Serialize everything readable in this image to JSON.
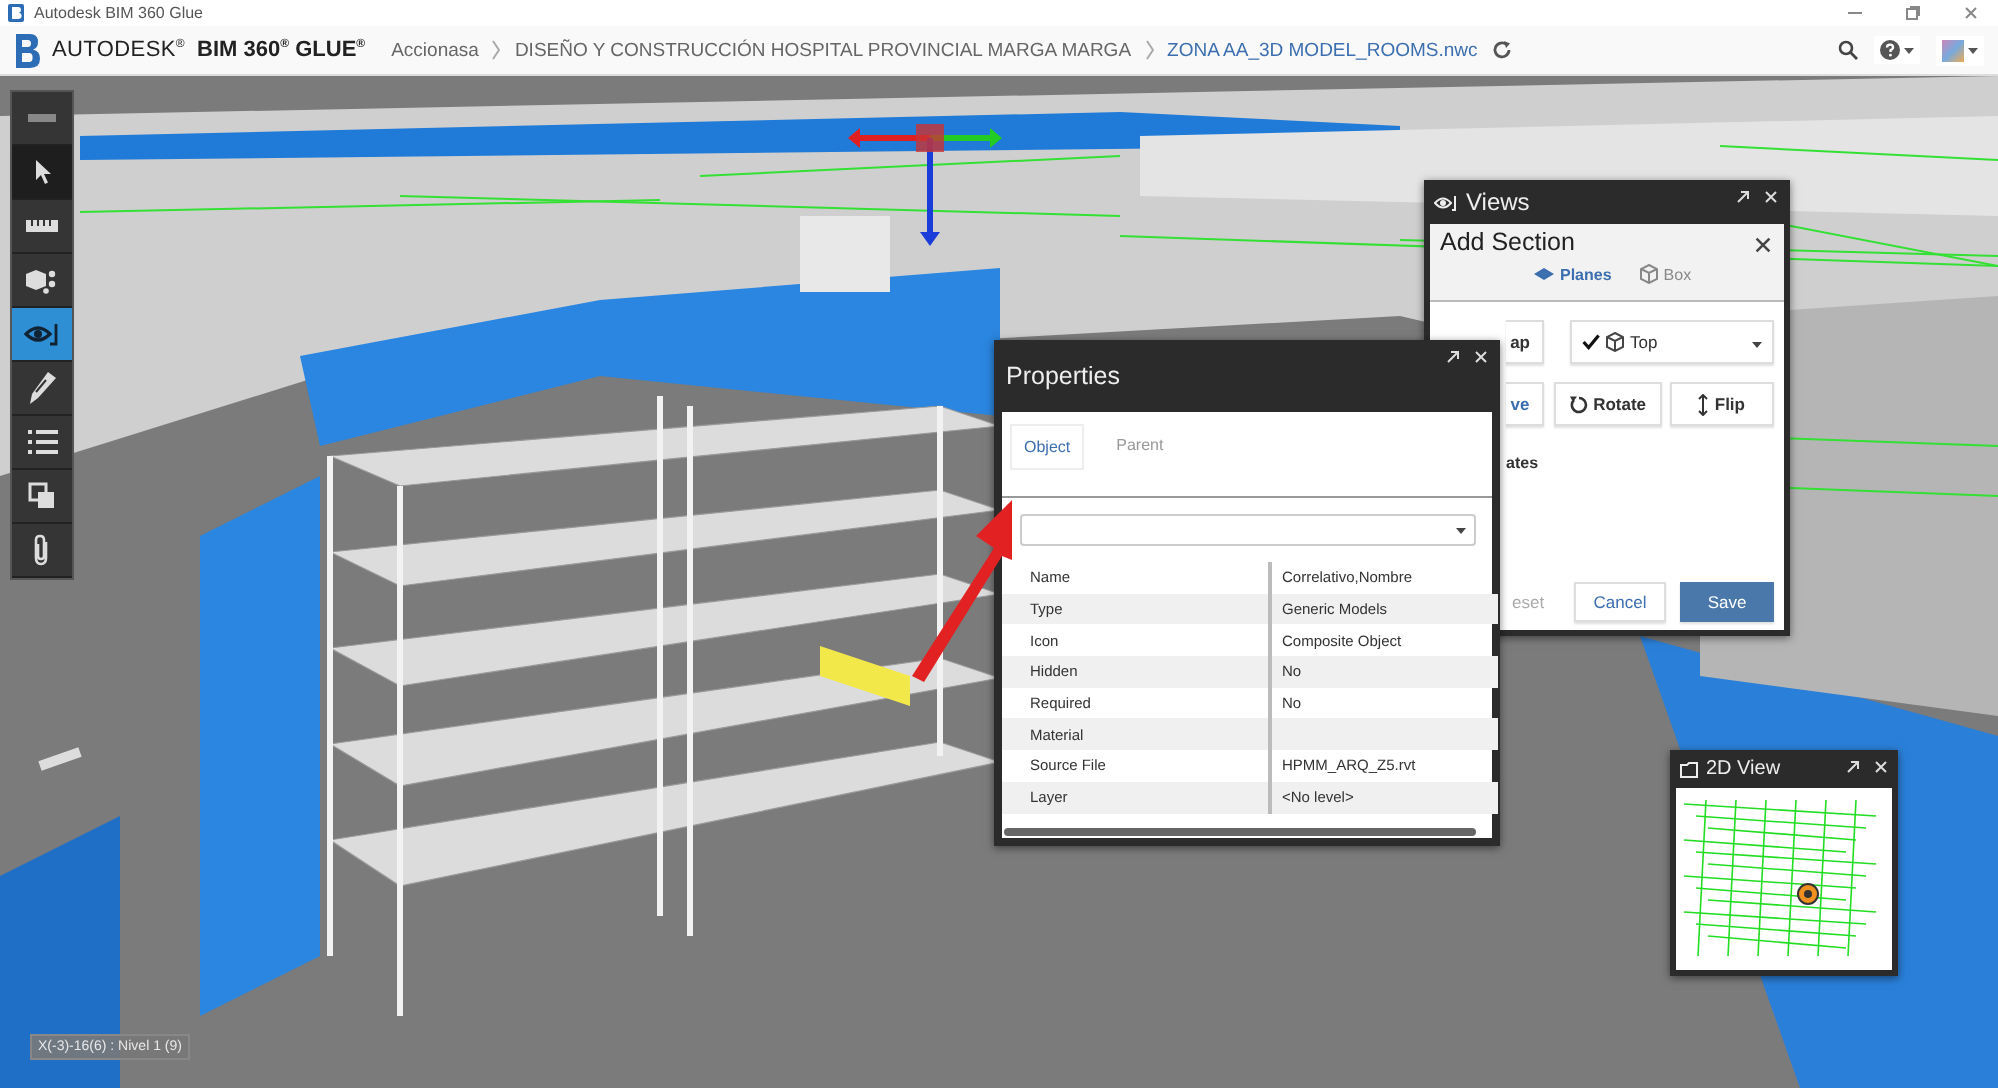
{
  "window": {
    "title": "Autodesk BIM 360 Glue"
  },
  "header": {
    "brand_prefix": "AUTODESK$^{®}$",
    "brand_product": "BIM 360$^{®}$ GLUE$^{®}$",
    "breadcrumbs": [
      {
        "label": "Accionasa",
        "current": false
      },
      {
        "label": "DISEÑO Y CONSTRUCCIÓN HOSPITAL PROVINCIAL MARGA MARGA",
        "current": false
      },
      {
        "label": "ZONA AA_3D MODEL_ROOMS.nwc",
        "current": true
      }
    ]
  },
  "toolbar": {
    "items": [
      {
        "selected": false,
        "active": false
      },
      {
        "selected": false,
        "active": true
      },
      {
        "selected": false,
        "active": false
      },
      {
        "selected": false,
        "active": false
      },
      {
        "selected": true,
        "active": false
      },
      {
        "selected": false,
        "active": false
      },
      {
        "selected": false,
        "active": false
      },
      {
        "selected": false,
        "active": false
      },
      {
        "selected": false,
        "active": false
      }
    ]
  },
  "views": {
    "title": "Views",
    "section_title": "Add Section",
    "tabs": [
      {
        "label": "Planes",
        "selected": true
      },
      {
        "label": "Box",
        "selected": false
      }
    ],
    "snap_button": "ap",
    "plane": {
      "label": "Top",
      "checked": true
    },
    "move_button": "ve",
    "rotate_button": "Rotate",
    "flip_button": "Flip",
    "coordinates_label": "ates",
    "reset_button": {
      "label": "eset",
      "disabled": true
    },
    "cancel_button": "Cancel",
    "save_button": "Save"
  },
  "properties": {
    "title": "Properties",
    "tabs": [
      {
        "label": "Object",
        "selected": true
      },
      {
        "label": "Parent",
        "selected": false
      }
    ],
    "rows": [
      {
        "name": "Name",
        "value": "Correlativo,Nombre"
      },
      {
        "name": "Type",
        "value": "Generic Models"
      },
      {
        "name": "Icon",
        "value": "Composite Object"
      },
      {
        "name": "Hidden",
        "value": "No"
      },
      {
        "name": "Required",
        "value": "No"
      },
      {
        "name": "Material"
      },
      {
        "name": "Source File",
        "value": "HPMM_ARQ_Z5.rvt"
      },
      {
        "name": "Layer",
        "value": "<No level>"
      }
    ]
  },
  "map": {
    "title": "2D View"
  },
  "status": "X(-3)-16(6) : Nivel 1 (9)"
}
